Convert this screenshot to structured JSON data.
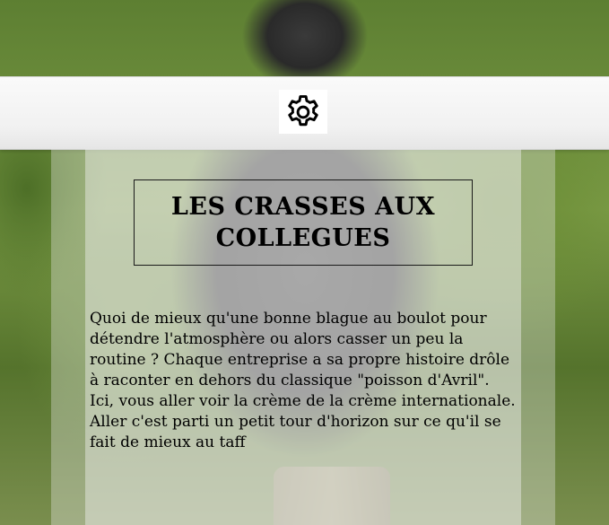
{
  "header": {
    "settings_icon": "gear-icon"
  },
  "main": {
    "title": "LES CRASSES AUX COLLEGUES",
    "intro": "Quoi de mieux qu'une bonne blague au boulot pour détendre l'atmosphère ou alors casser un peu la routine ? Chaque entreprise a sa propre histoire drôle à raconter en dehors du classique \"poisson d'Avril\". Ici, vous aller voir la crème de la crème internationale. Aller c'est parti un petit tour d'horizon sur ce qu'il se fait de mieux au taff"
  },
  "colors": {
    "header_bg": "#f2f2f2",
    "text": "#000000"
  }
}
